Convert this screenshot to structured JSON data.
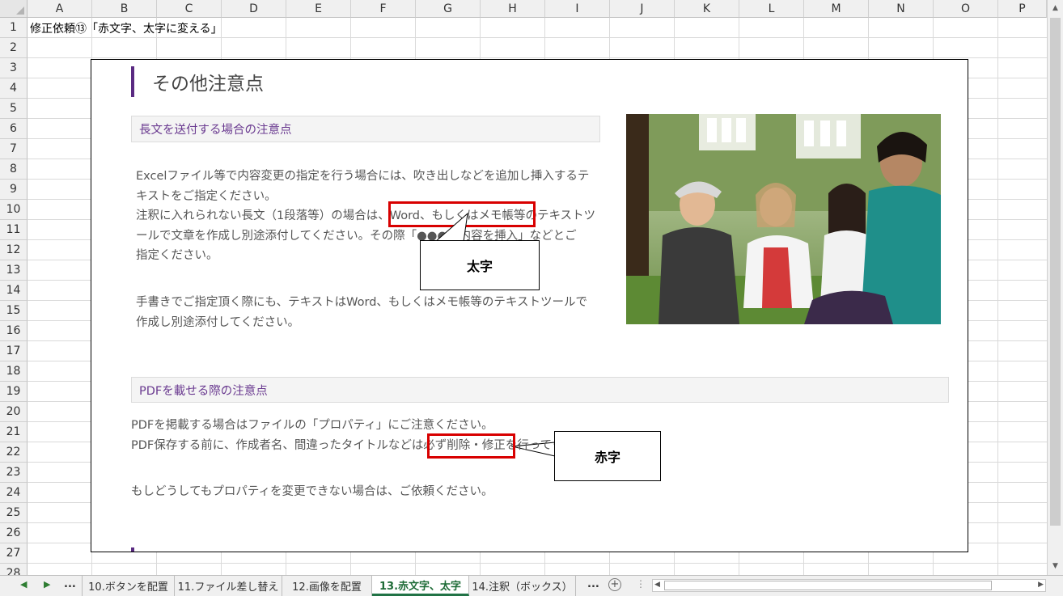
{
  "columns": [
    "A",
    "B",
    "C",
    "D",
    "E",
    "F",
    "G",
    "H",
    "I",
    "J",
    "K",
    "L",
    "M",
    "N",
    "O",
    "P"
  ],
  "rows": [
    "1",
    "2",
    "3",
    "4",
    "5",
    "6",
    "7",
    "8",
    "9",
    "10",
    "11",
    "12",
    "13",
    "14",
    "15",
    "16",
    "17",
    "18",
    "19",
    "20",
    "21",
    "22",
    "23",
    "24",
    "25",
    "26",
    "27",
    "28"
  ],
  "cell_a1": "修正依頼⑬「赤文字、太字に変える」",
  "embed": {
    "title": "その他注意点",
    "section1": {
      "heading": "長文を送付する場合の注意点",
      "para1": [
        "Excelファイル等で内容変更の指定を行う場合には、吹き出しなどを追加し挿入するテ",
        "キストをご指定ください。",
        "注釈に入れられない長文（1段落等）の場合は、Word、もしくはメモ帳等のテキストツ",
        "ールで文章を作成し別途添付してください。その際「●●●の内容を挿入」などとご",
        "指定ください。"
      ],
      "para2": [
        "手書きでご指定頂く際にも、テキストはWord、もしくはメモ帳等のテキストツールで",
        "作成し別途添付してください。"
      ]
    },
    "section2": {
      "heading": "PDFを載せる際の注意点",
      "para1": [
        "PDFを掲載する場合はファイルの「プロパティ」にご注意ください。",
        "PDF保存する前に、作成者名、間違ったタイトルなどは必ず削除・修正を行ってください。"
      ],
      "para2": "もしどうしてもプロパティを変更できない場合は、ご依頼ください。"
    },
    "callout_bold": "太字",
    "callout_red": "赤字"
  },
  "tabs": {
    "items": [
      "10.ボタンを配置",
      "11.ファイル差し替え",
      "12.画像を配置",
      "13.赤文字、太字",
      "14.注釈（ボックス）"
    ],
    "active_index": 3,
    "ellipsis": "..."
  },
  "colors": {
    "accent": "#5a2a82",
    "highlight": "#d80000",
    "excel_green": "#217346"
  }
}
